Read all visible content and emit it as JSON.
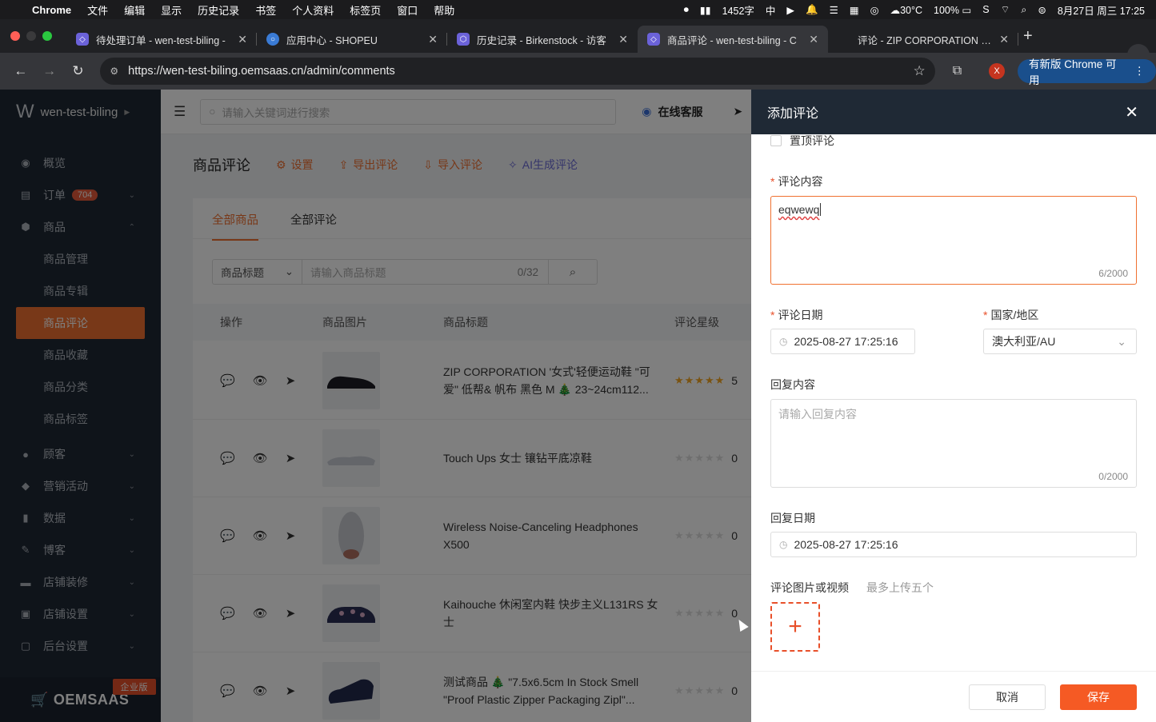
{
  "macbar": {
    "app": "Chrome",
    "menus": [
      "文件",
      "编辑",
      "显示",
      "历史记录",
      "书签",
      "个人资料",
      "标签页",
      "窗口",
      "帮助"
    ],
    "word_count": "1452字",
    "temp": "30°C",
    "battery": "100%",
    "datetime": "8月27日 周三 17:25"
  },
  "tabs": [
    {
      "title": "待处理订单 - wen-test-biling -",
      "color": "#6b62d9"
    },
    {
      "title": "应用中心 - SHOPEU",
      "color": "#3a7bd5"
    },
    {
      "title": "历史记录 - Birkenstock - 访客",
      "color": "#6b62d9"
    },
    {
      "title": "商品评论 - wen-test-biling - C",
      "color": "#6b62d9"
    },
    {
      "title": "评论 - ZIP CORPORATION '女式",
      "color": "#888888"
    }
  ],
  "address": {
    "url": "https://wen-test-biling.oemsaas.cn/admin/comments",
    "avatar": "X",
    "update_label": "有新版 Chrome 可用"
  },
  "sidebar": {
    "shop_name": "wen-test-biling",
    "items": [
      {
        "label": "概览",
        "icon": "dashboard-icon"
      },
      {
        "label": "订单",
        "icon": "order-icon",
        "badge": "704"
      },
      {
        "label": "商品",
        "icon": "box-icon"
      },
      {
        "label": "顾客",
        "icon": "user-icon"
      },
      {
        "label": "营销活动",
        "icon": "tag-icon"
      },
      {
        "label": "数据",
        "icon": "chart-icon"
      },
      {
        "label": "博客",
        "icon": "edit-icon"
      },
      {
        "label": "店铺装修",
        "icon": "brush-icon"
      },
      {
        "label": "店铺设置",
        "icon": "store-icon"
      },
      {
        "label": "后台设置",
        "icon": "settings-icon"
      }
    ],
    "sub_items": [
      "商品管理",
      "商品专辑",
      "商品评论",
      "商品收藏",
      "商品分类",
      "商品标签"
    ],
    "brand": "OEMSAAS",
    "edition": "企业版"
  },
  "topbar": {
    "search_placeholder": "请输入关键词进行搜索",
    "support": "在线客服"
  },
  "page": {
    "title": "商品评论",
    "actions": [
      "设置",
      "导出评论",
      "导入评论",
      "AI生成评论"
    ],
    "tabs": [
      "全部商品",
      "全部评论"
    ],
    "filter_select": "商品标题",
    "filter_placeholder": "请输入商品标题",
    "filter_count": "0/32",
    "columns": [
      "操作",
      "商品图片",
      "商品标题",
      "评论星级"
    ]
  },
  "products": [
    {
      "title": "ZIP CORPORATION '女式'轻便运动鞋 \"可爱\" 低帮& 帆布 黑色 M 🎄 23~24cm112...",
      "rating": 5,
      "count": "5"
    },
    {
      "title": "Touch Ups 女士 镶钻平底凉鞋",
      "rating": 0,
      "count": "0"
    },
    {
      "title": "Wireless Noise-Canceling Headphones X500",
      "rating": 0,
      "count": "0"
    },
    {
      "title": "Kaihouche 休闲室内鞋 快步主义L131RS 女士",
      "rating": 0,
      "count": "0"
    },
    {
      "title": "测试商品 🎄 \"7.5x6.5cm In Stock Smell \"Proof Plastic Zipper Packaging Zipl\"...",
      "rating": 0,
      "count": "0"
    }
  ],
  "drawer": {
    "title": "添加评论",
    "pin_label": "置顶评论",
    "content_label": "评论内容",
    "content_value": "eqwewq",
    "content_count": "6/2000",
    "date_label": "评论日期",
    "date_value": "2025-08-27 17:25:16",
    "country_label": "国家/地区",
    "country_value": "澳大利亚/AU",
    "reply_label": "回复内容",
    "reply_placeholder": "请输入回复内容",
    "reply_count": "0/2000",
    "reply_date_label": "回复日期",
    "reply_date_value": "2025-08-27 17:25:16",
    "media_label": "评论图片或视频",
    "media_hint": "最多上传五个",
    "cancel": "取消",
    "save": "保存"
  }
}
